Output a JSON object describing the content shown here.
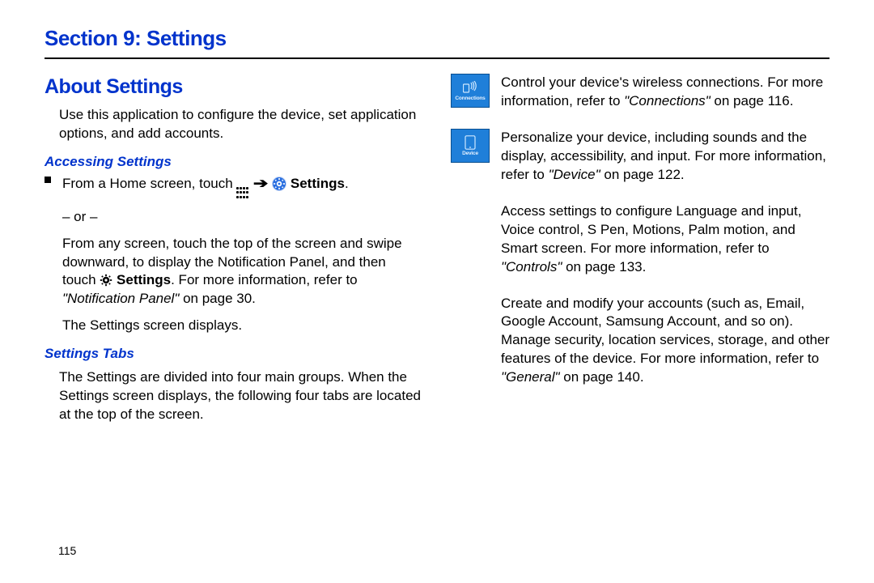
{
  "section_title": "Section 9: Settings",
  "about": {
    "heading": "About Settings",
    "intro": "Use this application to configure the device, set application options, and add accounts.",
    "accessing_heading": "Accessing Settings",
    "line1_pre": "From a Home screen, touch ",
    "line1_settings": "Settings",
    "line1_post": ".",
    "or": "– or –",
    "line2_a": "From any screen, touch the top of the screen and swipe downward, to display the Notification Panel, and then touch ",
    "line2_settings": "Settings",
    "line2_b": ". For more information, refer to ",
    "line2_ref": "\"Notification Panel\"",
    "line2_page": " on page 30.",
    "line3": "The Settings screen displays.",
    "tabs_heading": "Settings Tabs",
    "tabs_intro": "The Settings are divided into four main groups. When the Settings screen displays, the following four tabs are located at the top of the screen."
  },
  "tabs": {
    "connections": {
      "label": "Connections",
      "text_a": "Control your device's wireless connections. For more information, refer to ",
      "ref": "\"Connections\"",
      "text_b": " on page 116."
    },
    "device": {
      "label": "Device",
      "text_a": "Personalize your device, including sounds and the display, accessibility, and input. For more information, refer to ",
      "ref": "\"Device\"",
      "text_b": " on page 122."
    },
    "controls": {
      "text_a": "Access settings to configure Language and input, Voice control, S Pen, Motions, Palm motion, and Smart screen. For more information, refer to ",
      "ref": "\"Controls\"",
      "text_b": " on page 133."
    },
    "general": {
      "text_a": "Create and modify your accounts (such as, Email, Google Account, Samsung Account, and so on). Manage security, location services, storage, and other features of the device. For more information, refer to ",
      "ref": "\"General\"",
      "text_b": " on page 140."
    }
  },
  "page_number": "115"
}
